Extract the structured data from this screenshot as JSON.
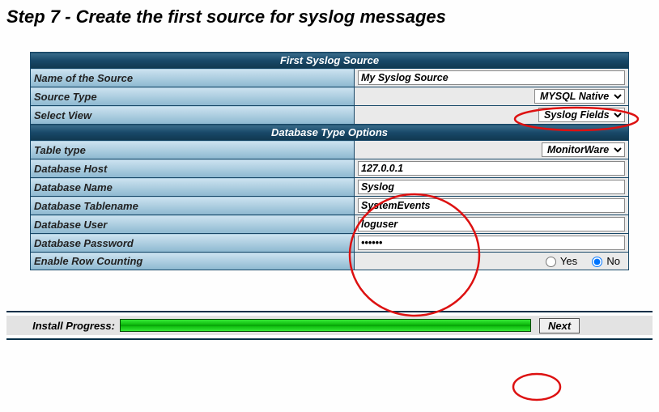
{
  "page_title": "Step 7 - Create the first source for syslog messages",
  "section1_header": "First Syslog Source",
  "section2_header": "Database Type Options",
  "rows": {
    "name_label": "Name of the Source",
    "name_value": "My Syslog Source",
    "type_label": "Source Type",
    "type_value": "MYSQL Native",
    "view_label": "Select View",
    "view_value": "Syslog Fields",
    "tabletype_label": "Table type",
    "tabletype_value": "MonitorWare",
    "host_label": "Database Host",
    "host_value": "127.0.0.1",
    "dbname_label": "Database Name",
    "dbname_value": "Syslog",
    "tablename_label": "Database Tablename",
    "tablename_value": "SystemEvents",
    "user_label": "Database User",
    "user_value": "loguser",
    "password_label": "Database Password",
    "password_value": "••••••",
    "rowcount_label": "Enable Row Counting",
    "rowcount_yes": "Yes",
    "rowcount_no": "No",
    "rowcount_selected": "No"
  },
  "footer": {
    "progress_label": "Install Progress:",
    "progress_percent": 100,
    "next_label": "Next"
  }
}
